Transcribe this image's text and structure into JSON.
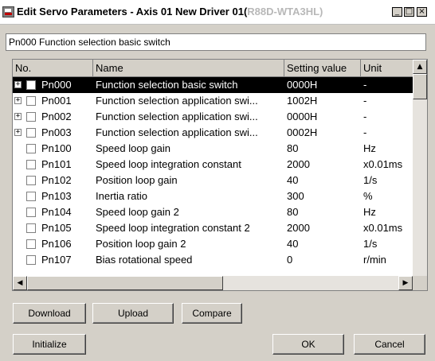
{
  "window": {
    "title_main": "Edit Servo Parameters - Axis 01 New Driver 01(",
    "title_dim": "R88D-WTA3HL)",
    "minimize_label": "_",
    "maximize_label": "□",
    "close_label": "×"
  },
  "description": "Pn000 Function selection basic switch",
  "table": {
    "headers": {
      "no": "No.",
      "name": "Name",
      "setting": "Setting value",
      "unit": "Unit"
    },
    "rows": [
      {
        "no": "Pn000",
        "name": "Function selection basic switch",
        "setting": "0000H",
        "unit": "-",
        "expandable": true,
        "selected": true
      },
      {
        "no": "Pn001",
        "name": "Function selection application swi...",
        "setting": "1002H",
        "unit": "-",
        "expandable": true,
        "selected": false
      },
      {
        "no": "Pn002",
        "name": "Function selection application swi...",
        "setting": "0000H",
        "unit": "-",
        "expandable": true,
        "selected": false
      },
      {
        "no": "Pn003",
        "name": "Function selection application swi...",
        "setting": "0002H",
        "unit": "-",
        "expandable": true,
        "selected": false
      },
      {
        "no": "Pn100",
        "name": "Speed loop gain",
        "setting": "80",
        "unit": "Hz",
        "expandable": false,
        "selected": false
      },
      {
        "no": "Pn101",
        "name": "Speed loop integration constant",
        "setting": "2000",
        "unit": "x0.01ms",
        "expandable": false,
        "selected": false
      },
      {
        "no": "Pn102",
        "name": "Position loop gain",
        "setting": "40",
        "unit": "1/s",
        "expandable": false,
        "selected": false
      },
      {
        "no": "Pn103",
        "name": "Inertia ratio",
        "setting": "300",
        "unit": "%",
        "expandable": false,
        "selected": false
      },
      {
        "no": "Pn104",
        "name": "Speed loop gain 2",
        "setting": "80",
        "unit": "Hz",
        "expandable": false,
        "selected": false
      },
      {
        "no": "Pn105",
        "name": "Speed loop integration constant 2",
        "setting": "2000",
        "unit": "x0.01ms",
        "expandable": false,
        "selected": false
      },
      {
        "no": "Pn106",
        "name": "Position loop gain 2",
        "setting": "40",
        "unit": "1/s",
        "expandable": false,
        "selected": false
      },
      {
        "no": "Pn107",
        "name": "Bias rotational speed",
        "setting": "0",
        "unit": "r/min",
        "expandable": false,
        "selected": false
      }
    ],
    "expander_glyph": "+",
    "scroll_up": "▲",
    "scroll_left": "◀",
    "scroll_right": "▶"
  },
  "buttons": {
    "download": "Download",
    "upload": "Upload",
    "compare": "Compare",
    "initialize": "Initialize",
    "ok": "OK",
    "cancel": "Cancel"
  }
}
